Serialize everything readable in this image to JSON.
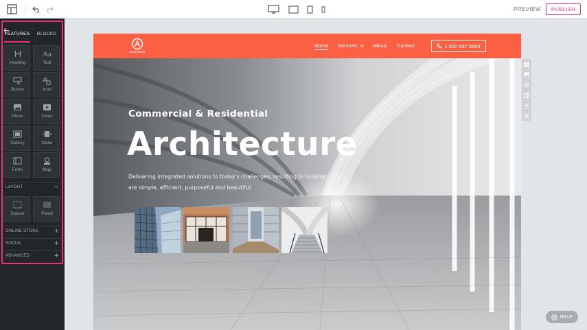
{
  "toolbar": {
    "layout_icon": "layout-icon",
    "undo_icon": "undo-icon",
    "redo_icon": "redo-icon",
    "devices": [
      "desktop-icon",
      "laptop-icon",
      "tablet-icon",
      "mobile-icon"
    ],
    "preview_label": "PREVIEW",
    "publish_label": "PUBLISH",
    "accent_color": "#e8356e"
  },
  "sidebar": {
    "tabs": [
      {
        "label": "FEATURES",
        "active": true
      },
      {
        "label": "BLOCKS",
        "active": false
      }
    ],
    "features": [
      {
        "label": "Heading",
        "icon": "heading-icon"
      },
      {
        "label": "Text",
        "icon": "text-icon"
      },
      {
        "label": "Button",
        "icon": "button-icon"
      },
      {
        "label": "Icon",
        "icon": "shapes-icon"
      },
      {
        "label": "Photo",
        "icon": "photo-icon"
      },
      {
        "label": "Video",
        "icon": "video-icon"
      },
      {
        "label": "Gallery",
        "icon": "gallery-icon"
      },
      {
        "label": "Slider",
        "icon": "slider-icon"
      },
      {
        "label": "Form",
        "icon": "form-icon"
      },
      {
        "label": "Map",
        "icon": "map-icon"
      }
    ],
    "layout_section": {
      "label": "LAYOUT",
      "toggle": "−"
    },
    "layout_items": [
      {
        "label": "Spacer",
        "icon": "spacer-icon"
      },
      {
        "label": "Panel",
        "icon": "panel-icon"
      }
    ],
    "sections": [
      {
        "label": "ONLINE STORE",
        "toggle": "+"
      },
      {
        "label": "SOCIAL",
        "toggle": "+"
      },
      {
        "label": "ADVANCED",
        "toggle": "+"
      }
    ]
  },
  "site": {
    "brand_color": "#fb6043",
    "logo_text": "ARCHITECH",
    "nav": [
      {
        "label": "Home",
        "active": true
      },
      {
        "label": "Services",
        "has_dropdown": true
      },
      {
        "label": "About"
      },
      {
        "label": "Contact"
      }
    ],
    "phone": "1 800 567 8899",
    "hero": {
      "subtitle": "Commercial & Residential",
      "title": "Architecture",
      "description": "Delivering integrated solutions to today's challenges, resulting in buildings which are simple, efficient, purposeful and beautiful."
    },
    "thumbnails": [
      "building-photo",
      "storefront-photo",
      "courtyard-photo",
      "staircase-photo"
    ]
  },
  "block_tools": [
    "columns-icon",
    "image-icon",
    "move-icon",
    "duplicate-icon",
    "download-icon",
    "close-icon"
  ],
  "help_label": "HELP"
}
